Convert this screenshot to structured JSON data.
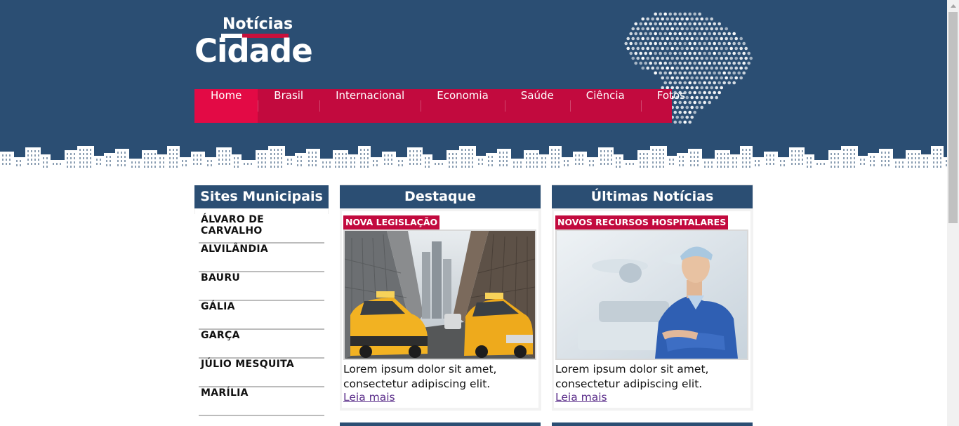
{
  "logo": {
    "line1": "Notícias",
    "line2": "Cidade"
  },
  "nav": [
    {
      "label": "Home",
      "active": true
    },
    {
      "label": "Brasil"
    },
    {
      "label": "Internacional"
    },
    {
      "label": "Economia"
    },
    {
      "label": "Saúde"
    },
    {
      "label": "Ciência"
    },
    {
      "label": "Fotos"
    }
  ],
  "sidebar": {
    "title": "Sites Municipais",
    "items": [
      "ÁLVARO DE CARVALHO",
      "ALVILÂNDIA",
      "BAURU",
      "GÁLIA",
      "GARÇA",
      "JÚLIO MESQUITA",
      "MARÍLIA"
    ]
  },
  "destaque": {
    "title": "Destaque",
    "tag": "NOVA LEGISLAÇÃO",
    "text": "Lorem ipsum dolor sit amet, consectetur adipiscing elit.",
    "link": "Leia mais"
  },
  "ultimas": {
    "title": "Últimas Notícias",
    "tag": "NOVOS RECURSOS HOSPITALARES",
    "text": "Lorem ipsum dolor sit amet, consectetur adipiscing elit.",
    "link": "Leia mais"
  },
  "colors": {
    "header": "#2b4e73",
    "nav": "#c20a3e",
    "nav_active": "#e30a45",
    "link": "#5b2e8a"
  },
  "icons": {
    "map": "brazil-dot-map",
    "skyline": "city-skyline",
    "scroll_up": "scroll-up-arrow"
  }
}
